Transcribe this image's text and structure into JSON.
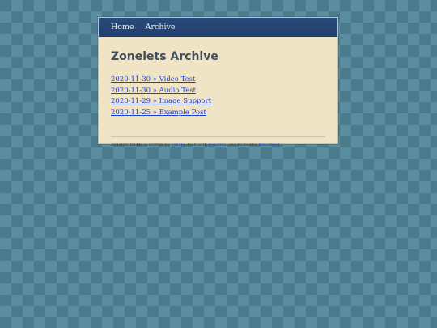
{
  "nav": {
    "home_label": "Home",
    "archive_label": "Archive"
  },
  "page": {
    "title": "Zonelets Archive"
  },
  "archive": {
    "posts": [
      {
        "label": "2020-11-30 » Video Test"
      },
      {
        "label": "2020-11-30 » Audio Test"
      },
      {
        "label": "2020-11-29 » Image Support"
      },
      {
        "label": "2020-11-25 » Example Post"
      }
    ]
  },
  "footer": {
    "text_1": "Zonelets Buddy is written by ",
    "link_author": "candle",
    "text_2": ", built with ",
    "link_zonelets": "Zonelets",
    "text_3": ", and hosted by ",
    "link_neocities": "Neocities!"
  },
  "colors": {
    "nav_bg": "#223f6d",
    "panel_bg": "#f0e4c7",
    "link": "#1f3fd8",
    "heading": "#3f4f5f",
    "page_bg": "#4d7b8e"
  }
}
